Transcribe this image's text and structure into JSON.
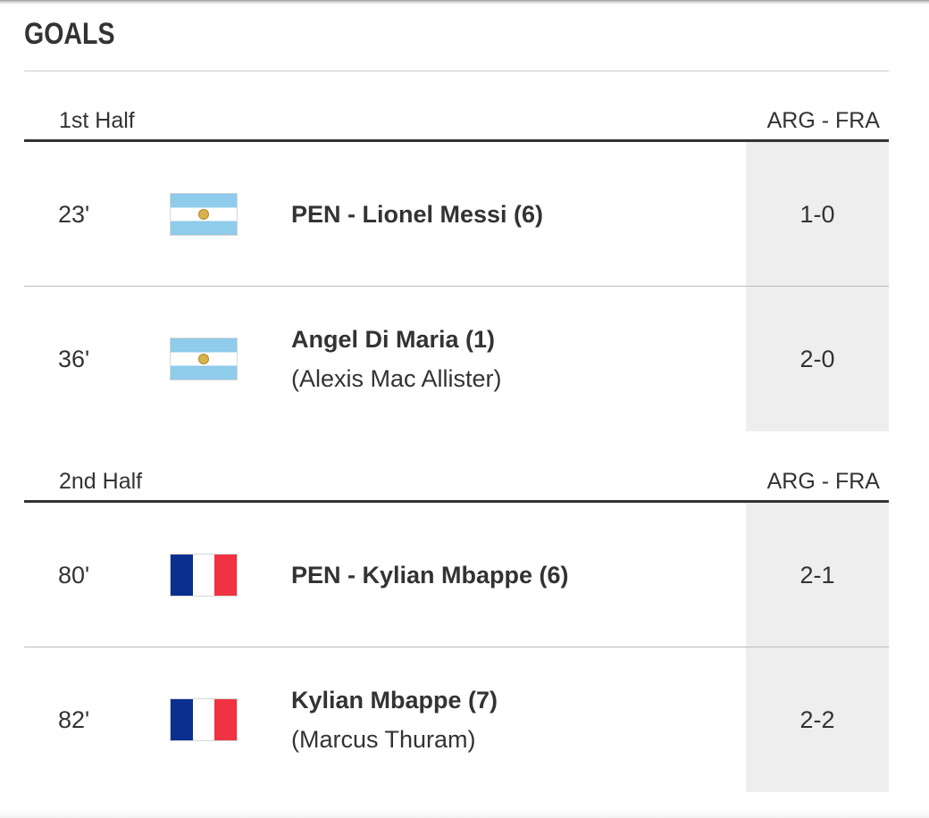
{
  "section_title": "GOALS",
  "halves": [
    {
      "label": "1st Half",
      "teams": "ARG - FRA",
      "goals": [
        {
          "minute": "23'",
          "team": "ARG",
          "scorer": "PEN - Lionel Messi (6)",
          "assist": "",
          "score": "1-0"
        },
        {
          "minute": "36'",
          "team": "ARG",
          "scorer": "Angel Di Maria (1)",
          "assist": "(Alexis Mac Allister)",
          "score": "2-0"
        }
      ]
    },
    {
      "label": "2nd Half",
      "teams": "ARG - FRA",
      "goals": [
        {
          "minute": "80'",
          "team": "FRA",
          "scorer": "PEN - Kylian Mbappe (6)",
          "assist": "",
          "score": "2-1"
        },
        {
          "minute": "82'",
          "team": "FRA",
          "scorer": "Kylian Mbappe (7)",
          "assist": "(Marcus Thuram)",
          "score": "2-2"
        }
      ]
    }
  ],
  "colors": {
    "text": "#333333",
    "score_bg": "#eeeeee",
    "argentina_blue": "#8fcbeb",
    "argentina_sun": "#d8b24a",
    "france_blue": "#0a2f8f",
    "france_white": "#ffffff",
    "france_red": "#ef3340"
  },
  "icons": {
    "ARG": "argentina-flag-icon",
    "FRA": "france-flag-icon"
  }
}
